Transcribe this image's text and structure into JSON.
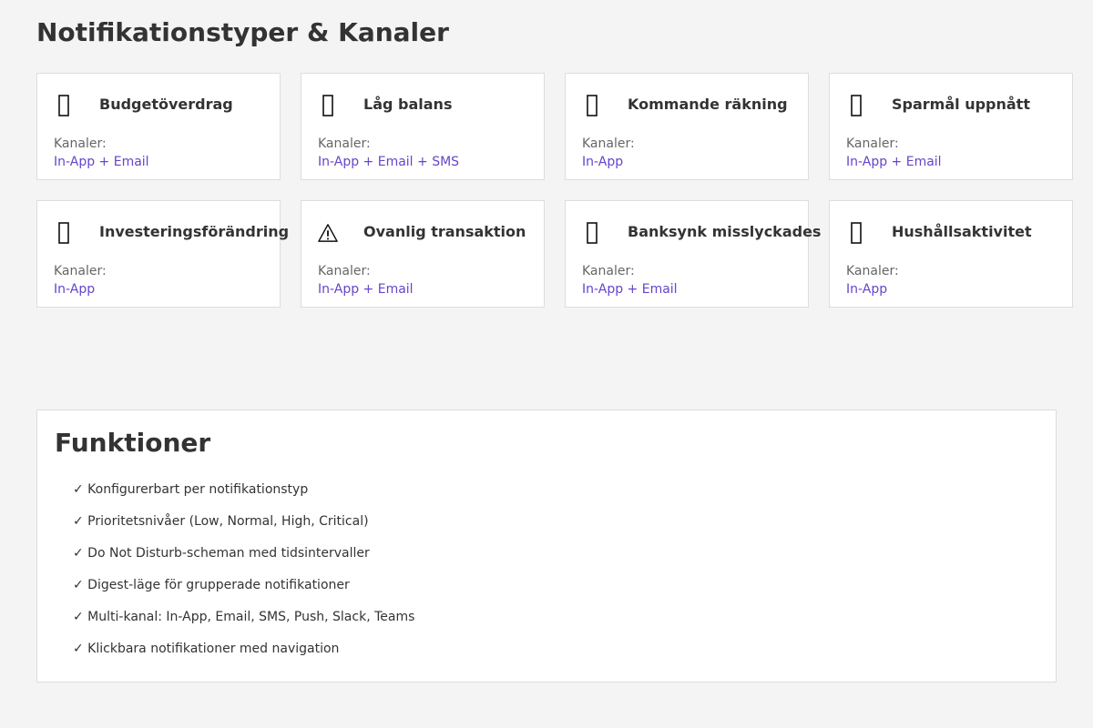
{
  "page": {
    "title": "Notifikationstyper & Kanaler"
  },
  "colors": {
    "background": "#f4f4f4",
    "card": "#ffffff",
    "border": "#dddddd",
    "accent": "#6644cc",
    "text": "#333333",
    "muted": "#666666"
  },
  "notification_types": [
    {
      "icon": "missing-glyph-icon",
      "title": "Budgetöverdrag",
      "channels_label": "Kanaler:",
      "channels": "In-App + Email"
    },
    {
      "icon": "missing-glyph-icon",
      "title": "Låg balans",
      "channels_label": "Kanaler:",
      "channels": "In-App + Email + SMS"
    },
    {
      "icon": "missing-glyph-icon",
      "title": "Kommande räkning",
      "channels_label": "Kanaler:",
      "channels": "In-App"
    },
    {
      "icon": "missing-glyph-icon",
      "title": "Sparmål uppnått",
      "channels_label": "Kanaler:",
      "channels": "In-App + Email"
    },
    {
      "icon": "missing-glyph-icon",
      "title": "Investeringsförändring",
      "channels_label": "Kanaler:",
      "channels": "In-App"
    },
    {
      "icon": "warning-icon",
      "title": "Ovanlig transaktion",
      "channels_label": "Kanaler:",
      "channels": "In-App + Email"
    },
    {
      "icon": "missing-glyph-icon",
      "title": "Banksynk misslyckades",
      "channels_label": "Kanaler:",
      "channels": "In-App + Email"
    },
    {
      "icon": "missing-glyph-icon",
      "title": "Hushållsaktivitet",
      "channels_label": "Kanaler:",
      "channels": "In-App"
    }
  ],
  "features": {
    "heading": "Funktioner",
    "items": [
      "✓ Konfigurerbart per notifikationstyp",
      "✓ Prioritetsnivåer (Low, Normal, High, Critical)",
      "✓ Do Not Disturb-scheman med tidsintervaller",
      "✓ Digest-läge för grupperade notifikationer",
      "✓ Multi-kanal: In-App, Email, SMS, Push, Slack, Teams",
      "✓ Klickbara notifikationer med navigation"
    ]
  }
}
